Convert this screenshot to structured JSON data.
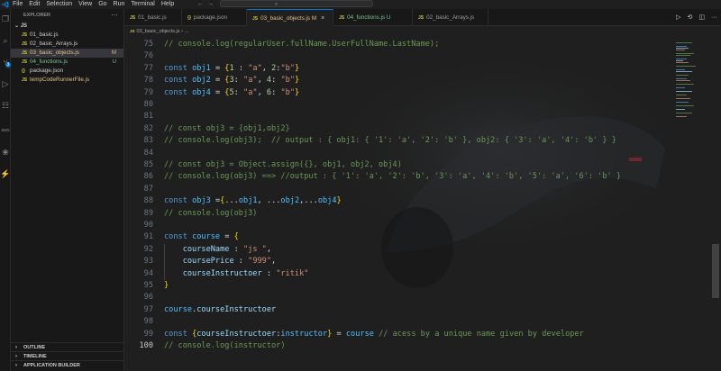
{
  "menu": [
    "File",
    "Edit",
    "Selection",
    "View",
    "Go",
    "Run",
    "Terminal",
    "Help"
  ],
  "command_center": {
    "search_glyph": "⌕"
  },
  "activity": [
    {
      "name": "explorer-icon",
      "glyph": "❐"
    },
    {
      "name": "search-icon",
      "glyph": "⌕"
    },
    {
      "name": "source-control-icon",
      "glyph": "⑂"
    },
    {
      "name": "run-debug-icon",
      "glyph": "▷"
    },
    {
      "name": "extensions-icon",
      "glyph": "☷"
    },
    {
      "name": "aws-icon",
      "glyph": "aws"
    },
    {
      "name": "python-icon",
      "glyph": "❀"
    },
    {
      "name": "pull-request-icon",
      "glyph": "⚡"
    }
  ],
  "sidebar": {
    "title": "EXPLORER",
    "more": "···",
    "folder": "JS",
    "files": [
      {
        "icon": "JS",
        "name": "01_basic.js",
        "status": "",
        "state": ""
      },
      {
        "icon": "JS",
        "name": "02_basic_Arrays.js",
        "status": "",
        "state": ""
      },
      {
        "icon": "JS",
        "name": "03_basic_objects.js",
        "status": "M",
        "state": "active mod"
      },
      {
        "icon": "JS",
        "name": "04_functions.js",
        "status": "U",
        "state": "untracked"
      },
      {
        "icon": "{}",
        "name": "package.json",
        "status": "",
        "state": ""
      },
      {
        "icon": "JS",
        "name": "tempCodeRunnerFile.js",
        "status": "",
        "state": "sel"
      }
    ],
    "panels": [
      "OUTLINE",
      "TIMELINE",
      "APPLICATION BUILDER"
    ]
  },
  "tabs": [
    {
      "icon": "JS",
      "name": "01_basic.js",
      "state": ""
    },
    {
      "icon": "{}",
      "name": "package.json",
      "state": ""
    },
    {
      "icon": "JS",
      "name": "03_basic_objects.js M",
      "state": "active"
    },
    {
      "icon": "JS",
      "name": "04_functions.js U",
      "state": "u"
    },
    {
      "icon": "JS",
      "name": "02_basic_Arrays.js",
      "state": ""
    }
  ],
  "breadcrumb": {
    "icon": "JS",
    "file": "03_basic_objects.js",
    "tail": "› …"
  },
  "editor": {
    "current_line": 100
  },
  "code": [
    {
      "n": 75,
      "html": "<span class='c-com'>// console.log(regularUser.fullName.UserFullName.LastName);</span>"
    },
    {
      "n": 76,
      "html": ""
    },
    {
      "n": 77,
      "html": "<span class='c-kw'>const</span> <span class='c-var'>obj1</span> = <span class='c-br1'>{</span><span class='c-num'>1</span> : <span class='c-str'>\"a\"</span>, <span class='c-num'>2</span>:<span class='c-str'>\"b\"</span><span class='c-br1'>}</span>"
    },
    {
      "n": 78,
      "html": "<span class='c-kw'>const</span> <span class='c-var'>obj2</span> = <span class='c-br1'>{</span><span class='c-num'>3</span>: <span class='c-str'>\"a\"</span>, <span class='c-num'>4</span>: <span class='c-str'>\"b\"</span><span class='c-br1'>}</span>"
    },
    {
      "n": 79,
      "html": "<span class='c-kw'>const</span> <span class='c-var'>obj4</span> = <span class='c-br1'>{</span><span class='c-num'>5</span>: <span class='c-str'>\"a\"</span>, <span class='c-num'>6</span>: <span class='c-str'>\"b\"</span><span class='c-br1'>}</span>"
    },
    {
      "n": 80,
      "html": ""
    },
    {
      "n": 81,
      "html": ""
    },
    {
      "n": 82,
      "html": "<span class='c-com'>// const obj3 = {obj1,obj2}</span>"
    },
    {
      "n": 83,
      "html": "<span class='c-com'>// console.log(obj3);  // output : { obj1: { '1': 'a', '2': 'b' }, obj2: { '3': 'a', '4': 'b' } }</span>"
    },
    {
      "n": 84,
      "html": ""
    },
    {
      "n": 85,
      "html": "<span class='c-com'>// const obj3 = Object.assign({}, obj1, obj2, obj4)</span>"
    },
    {
      "n": 86,
      "html": "<span class='c-com'>// console.log(obj3) ==> //output : { '1': 'a', '2': 'b', '3': 'a', '4': 'b', '5': 'a', '6': 'b' }</span>"
    },
    {
      "n": 87,
      "html": ""
    },
    {
      "n": 88,
      "html": "<span class='c-kw'>const</span> <span class='c-var'>obj3</span> =<span class='c-br1'>{</span>...<span class='c-var'>obj1</span>, ...<span class='c-var'>obj2</span>,...<span class='c-var'>obj4</span><span class='c-br1'>}</span>"
    },
    {
      "n": 89,
      "html": "<span class='c-com'>// console.log(obj3)</span>"
    },
    {
      "n": 90,
      "html": ""
    },
    {
      "n": 91,
      "html": "<span class='c-kw'>const</span> <span class='c-var'>course</span> = <span class='c-br1'>{</span>"
    },
    {
      "n": 92,
      "html": "    <span class='c-prop'>courseName</span> : <span class='c-str'>\"js \"</span>,"
    },
    {
      "n": 93,
      "html": "    <span class='c-prop'>coursePrice</span> : <span class='c-str'>\"999\"</span>,"
    },
    {
      "n": 94,
      "html": "    <span class='c-prop'>courseInstructoer</span> : <span class='c-str'>\"ritik\"</span>"
    },
    {
      "n": 95,
      "html": "<span class='c-br1'>}</span>"
    },
    {
      "n": 96,
      "html": ""
    },
    {
      "n": 97,
      "html": "<span class='c-var'>course</span>.<span class='c-prop'>courseInstructoer</span>"
    },
    {
      "n": 98,
      "html": ""
    },
    {
      "n": 99,
      "html": "<span class='c-kw'>const</span> <span class='c-br1'>{</span><span class='c-prop'>courseInstructoer</span>:<span class='c-var'>instructor</span><span class='c-br1'>}</span> = <span class='c-var'>course</span> <span class='c-com'>// acess by a unique name given by developer</span>"
    },
    {
      "n": 100,
      "html": "<span class='c-com'>// console.log(instructor)</span>"
    }
  ],
  "colors": {
    "accent": "#0078d4",
    "modified": "#e2c08d",
    "untracked": "#73c991"
  }
}
